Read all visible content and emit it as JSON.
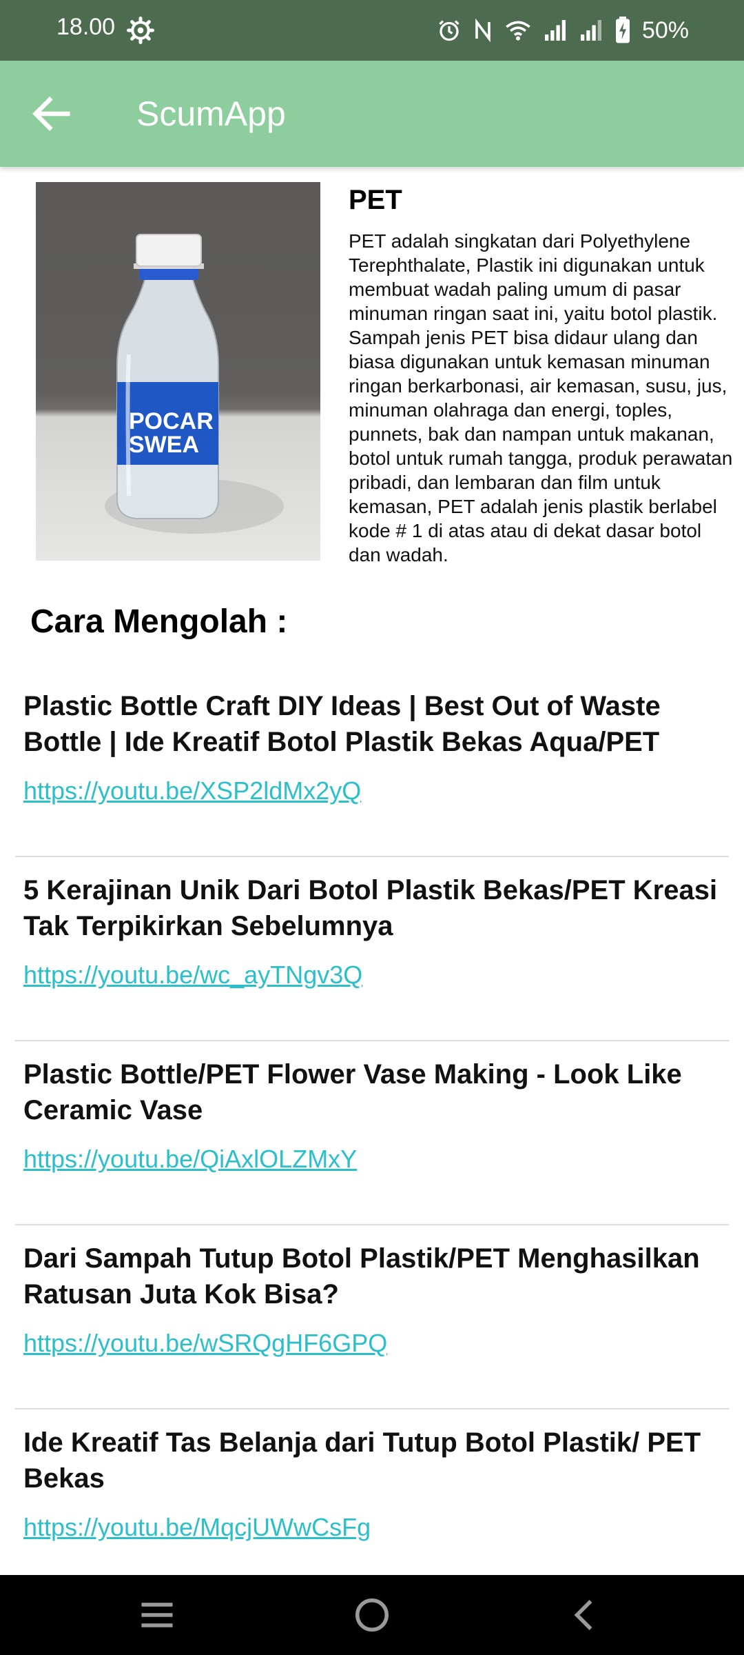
{
  "status_bar": {
    "time": "18.00",
    "battery": "50%",
    "icons": [
      "settings-icon",
      "alarm-icon",
      "nfc-icon",
      "wifi-icon",
      "signal-icon",
      "signal-icon",
      "battery-charging-icon"
    ]
  },
  "app_bar": {
    "title": "ScumApp",
    "back_icon": "arrow-left-icon"
  },
  "product": {
    "image_icon": "plastic-bottle-photo",
    "title": "PET",
    "description": "PET adalah singkatan dari Polyethylene Terephthalate, Plastik ini digunakan untuk membuat wadah paling umum di pasar minuman ringan saat ini, yaitu botol plastik. Sampah jenis PET bisa didaur ulang dan biasa digunakan untuk kemasan minuman ringan berkarbonasi, air kemasan, susu, jus, minuman olahraga dan energi, toples, punnets, bak dan nampan untuk makanan, botol untuk rumah tangga, produk perawatan pribadi, dan lembaran dan film untuk kemasan, PET adalah jenis plastik berlabel kode # 1 di atas atau di dekat dasar botol dan wadah."
  },
  "section": {
    "title": "Cara Mengolah :"
  },
  "videos": [
    {
      "title": "Plastic Bottle Craft DIY Ideas | Best Out of Waste Bottle | Ide Kreatif Botol Plastik Bekas Aqua/PET",
      "link": "https://youtu.be/XSP2ldMx2yQ"
    },
    {
      "title": "5 Kerajinan Unik Dari Botol Plastik Bekas/PET Kreasi Tak Terpikirkan Sebelumnya",
      "link": "https://youtu.be/wc_ayTNgv3Q"
    },
    {
      "title": "Plastic Bottle/PET Flower Vase Making - Look Like Ceramic Vase",
      "link": "https://youtu.be/QiAxlOLZMxY"
    },
    {
      "title": "Dari Sampah Tutup Botol Plastik/PET Menghasilkan Ratusan Juta Kok Bisa?",
      "link": "https://youtu.be/wSRQgHF6GPQ"
    },
    {
      "title": "Ide Kreatif Tas Belanja dari Tutup Botol Plastik/ PET Bekas",
      "link": "https://youtu.be/MqcjUWwCsFg"
    }
  ],
  "colors": {
    "status_bar": "#4d6b4e",
    "app_bar": "#8ecd9d",
    "link": "#2bbfca"
  },
  "nav_bar": {
    "icons": [
      "menu-icon",
      "home-icon",
      "back-icon"
    ]
  }
}
